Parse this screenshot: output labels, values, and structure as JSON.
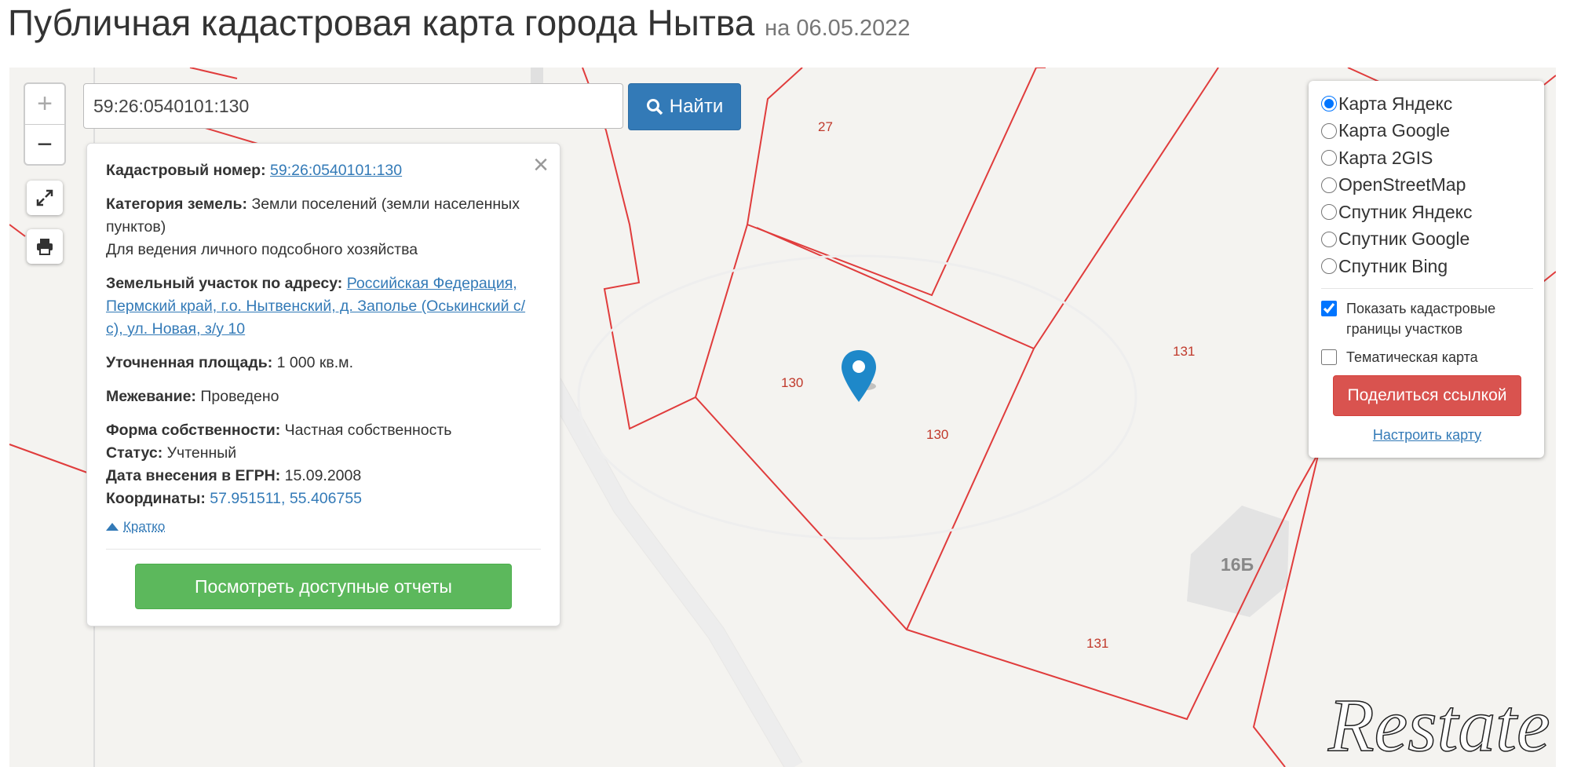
{
  "header": {
    "title": "Публичная кадастровая карта города Нытва",
    "date": "на 06.05.2022"
  },
  "search": {
    "value": "59:26:0540101:130",
    "button_label": "Найти"
  },
  "info": {
    "cadastral_label": "Кадастровый номер:",
    "cadastral_value": "59:26:0540101:130",
    "category_label": "Категория земель:",
    "category_value": "Земли поселений (земли населенных пунктов)",
    "usage": "Для ведения личного подсобного хозяйства",
    "address_label": "Земельный участок по адресу:",
    "address_value": "Российская Федерация, Пермский край, г.о. Нытвенский, д. Заполье (Оськинский с/с), ул. Новая, з/у 10",
    "area_label": "Уточненная площадь:",
    "area_value": "1 000 кв.м.",
    "survey_label": "Межевание:",
    "survey_value": "Проведено",
    "ownership_label": "Форма собственности:",
    "ownership_value": "Частная собственность",
    "status_label": "Статус:",
    "status_value": "Учтенный",
    "egrn_label": "Дата внесения в ЕГРН:",
    "egrn_value": "15.09.2008",
    "coords_label": "Координаты:",
    "coords_value": "57.951511, 55.406755",
    "collapse_label": "Кратко",
    "reports_button": "Посмотреть доступные отчеты"
  },
  "layers": {
    "options": [
      {
        "label": "Карта Яндекс",
        "selected": true
      },
      {
        "label": "Карта Google",
        "selected": false
      },
      {
        "label": "Карта 2GIS",
        "selected": false
      },
      {
        "label": "OpenStreetMap",
        "selected": false
      },
      {
        "label": "Спутник Яндекс",
        "selected": false
      },
      {
        "label": "Спутник Google",
        "selected": false
      },
      {
        "label": "Спутник Bing",
        "selected": false
      }
    ],
    "show_borders_label": "Показать кадастровые границы участков",
    "show_borders_checked": true,
    "thematic_label": "Тематическая карта",
    "thematic_checked": false,
    "share_button": "Поделиться ссылкой",
    "setup_link": "Настроить карту"
  },
  "map": {
    "plot_labels": [
      "27",
      "130",
      "130",
      "131",
      "131"
    ],
    "building_label": "16Б",
    "border_color": "#e03c3c",
    "logo_text": "Restate"
  }
}
